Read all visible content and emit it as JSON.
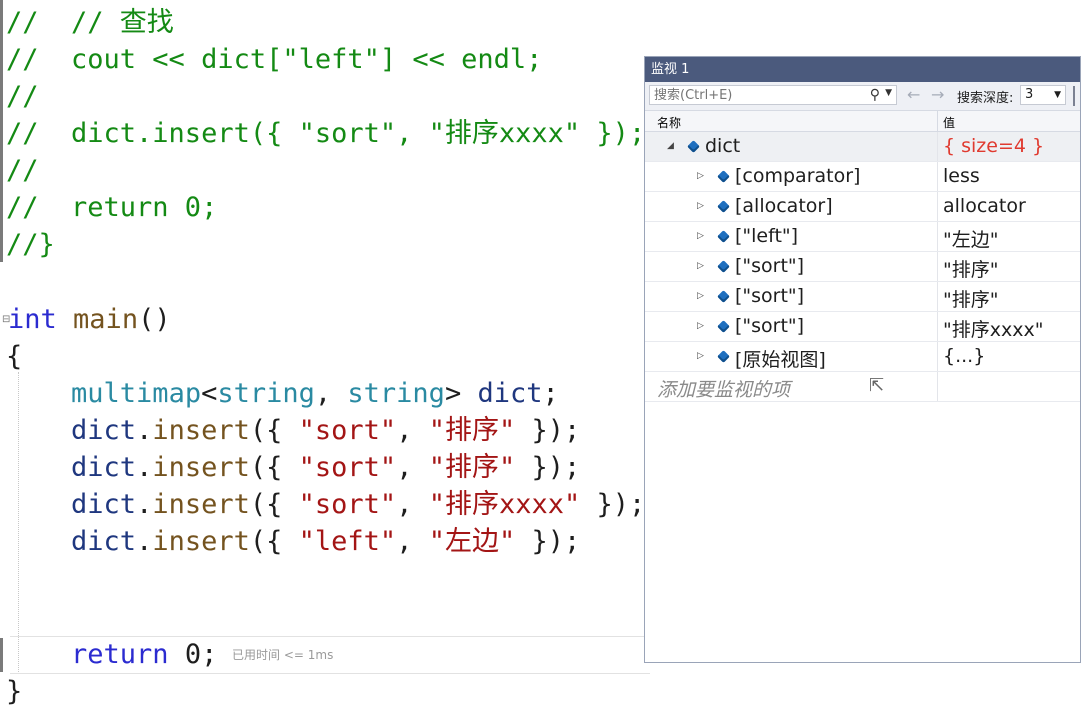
{
  "editor": {
    "lines": [
      {
        "parts": [
          [
            "c",
            "//  // 查找"
          ]
        ]
      },
      {
        "parts": [
          [
            "c",
            "//  cout << dict[\"left\"] << endl;"
          ]
        ]
      },
      {
        "parts": [
          [
            "c",
            "//"
          ]
        ]
      },
      {
        "parts": [
          [
            "c",
            "//  dict.insert({ \"sort\", \"排序xxxx\" });"
          ]
        ]
      },
      {
        "parts": [
          [
            "c",
            "//"
          ]
        ]
      },
      {
        "parts": [
          [
            "c",
            "//  return 0;"
          ]
        ]
      },
      {
        "parts": [
          [
            "c",
            "//}"
          ]
        ]
      },
      {
        "parts": [
          [
            "kw",
            "int"
          ],
          [
            "p",
            " "
          ],
          [
            "fn",
            "main"
          ],
          [
            "p",
            "()"
          ]
        ]
      },
      {
        "parts": [
          [
            "p",
            "{"
          ]
        ]
      },
      {
        "parts": [
          [
            "p",
            "    "
          ],
          [
            "ty",
            "multimap"
          ],
          [
            "p",
            "<"
          ],
          [
            "ty",
            "string"
          ],
          [
            "p",
            ", "
          ],
          [
            "ty",
            "string"
          ],
          [
            "p",
            "> "
          ],
          [
            "var",
            "dict"
          ],
          [
            "p",
            ";"
          ]
        ]
      },
      {
        "parts": [
          [
            "p",
            "    "
          ],
          [
            "var",
            "dict"
          ],
          [
            "p",
            "."
          ],
          [
            "fn",
            "insert"
          ],
          [
            "p",
            "({ "
          ],
          [
            "st",
            "\"sort\""
          ],
          [
            "p",
            ", "
          ],
          [
            "st",
            "\"排序\""
          ],
          [
            "p",
            " });"
          ]
        ]
      },
      {
        "parts": [
          [
            "p",
            "    "
          ],
          [
            "var",
            "dict"
          ],
          [
            "p",
            "."
          ],
          [
            "fn",
            "insert"
          ],
          [
            "p",
            "({ "
          ],
          [
            "st",
            "\"sort\""
          ],
          [
            "p",
            ", "
          ],
          [
            "st",
            "\"排序\""
          ],
          [
            "p",
            " });"
          ]
        ]
      },
      {
        "parts": [
          [
            "p",
            "    "
          ],
          [
            "var",
            "dict"
          ],
          [
            "p",
            "."
          ],
          [
            "fn",
            "insert"
          ],
          [
            "p",
            "({ "
          ],
          [
            "st",
            "\"sort\""
          ],
          [
            "p",
            ", "
          ],
          [
            "st",
            "\"排序xxxx\""
          ],
          [
            "p",
            " });"
          ]
        ]
      },
      {
        "parts": [
          [
            "p",
            "    "
          ],
          [
            "var",
            "dict"
          ],
          [
            "p",
            "."
          ],
          [
            "fn",
            "insert"
          ],
          [
            "p",
            "({ "
          ],
          [
            "st",
            "\"left\""
          ],
          [
            "p",
            ", "
          ],
          [
            "st",
            "\"左边\""
          ],
          [
            "p",
            " });"
          ]
        ]
      },
      {
        "parts": [
          [
            "p",
            "    "
          ],
          [
            "kw",
            "return"
          ],
          [
            "p",
            " 0;"
          ]
        ]
      },
      {
        "parts": [
          [
            "p",
            "}"
          ]
        ]
      }
    ],
    "perf_tip": "已用时间 <= 1ms"
  },
  "watch": {
    "title": "监视 1",
    "search_placeholder": "搜索(Ctrl+E)",
    "depth_label": "搜索深度:",
    "depth_value": "3",
    "col_name": "名称",
    "col_value": "值",
    "rows": [
      {
        "name": "dict",
        "value": "{ size=4 }",
        "expanded": true,
        "depth": 0
      },
      {
        "name": "[comparator]",
        "value": "less",
        "depth": 1
      },
      {
        "name": "[allocator]",
        "value": "allocator",
        "depth": 1
      },
      {
        "name": "[\"left\"]",
        "value": "\"左边\"",
        "depth": 1
      },
      {
        "name": "[\"sort\"]",
        "value": "\"排序\"",
        "depth": 1
      },
      {
        "name": "[\"sort\"]",
        "value": "\"排序\"",
        "depth": 1
      },
      {
        "name": "[\"sort\"]",
        "value": "\"排序xxxx\"",
        "depth": 1
      },
      {
        "name": "[原始视图]",
        "value": "{...}",
        "depth": 1
      }
    ],
    "add_watch_placeholder": "添加要监视的项"
  },
  "colors": {
    "comment": "#148a14",
    "keyword": "#2b2bd0",
    "type": "#2a8aa2",
    "string": "#a31515",
    "function": "#74531f",
    "variable": "#1f377f",
    "watch_title_bg": "#4b5a7d",
    "changed_value": "#e03a2f"
  },
  "icons": [
    "search-icon",
    "back-arrow-icon",
    "forward-arrow-icon",
    "expand-icon",
    "collapse-icon",
    "object-icon",
    "mouse-cursor-icon"
  ]
}
